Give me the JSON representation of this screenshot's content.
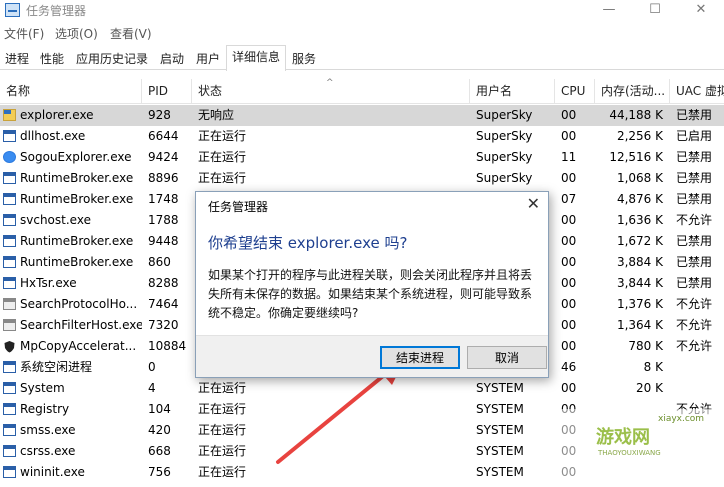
{
  "window": {
    "title": "任务管理器",
    "minimize": "—",
    "maximize": "☐",
    "close": "✕"
  },
  "menu": [
    "文件(F)",
    "选项(O)",
    "查看(V)"
  ],
  "tabs": [
    "进程",
    "性能",
    "应用历史记录",
    "启动",
    "用户",
    "详细信息",
    "服务"
  ],
  "active_tab": "详细信息",
  "columns": {
    "name": "名称",
    "pid": "PID",
    "status": "状态",
    "user": "用户名",
    "cpu": "CPU",
    "mem": "内存(活动...",
    "uac": "UAC 虚拟..."
  },
  "rows": [
    {
      "icon": "folder-icon",
      "name": "explorer.exe",
      "pid": "928",
      "status": "无响应",
      "user": "SuperSky",
      "cpu": "00",
      "mem": "44,188 K",
      "uac": "已禁用"
    },
    {
      "icon": "process-icon",
      "name": "dllhost.exe",
      "pid": "6644",
      "status": "正在运行",
      "user": "SuperSky",
      "cpu": "00",
      "mem": "2,256 K",
      "uac": "已启用"
    },
    {
      "icon": "sogou-icon",
      "name": "SogouExplorer.exe",
      "pid": "9424",
      "status": "正在运行",
      "user": "SuperSky",
      "cpu": "11",
      "mem": "12,516 K",
      "uac": "已禁用"
    },
    {
      "icon": "process-icon",
      "name": "RuntimeBroker.exe",
      "pid": "8896",
      "status": "正在运行",
      "user": "SuperSky",
      "cpu": "00",
      "mem": "1,068 K",
      "uac": "已禁用"
    },
    {
      "icon": "process-icon",
      "name": "RuntimeBroker.exe",
      "pid": "1748",
      "status": "",
      "user": "",
      "cpu": "07",
      "mem": "4,876 K",
      "uac": "已禁用"
    },
    {
      "icon": "process-icon",
      "name": "svchost.exe",
      "pid": "1788",
      "status": "",
      "user": "",
      "cpu": "00",
      "mem": "1,636 K",
      "uac": "不允许"
    },
    {
      "icon": "process-icon",
      "name": "RuntimeBroker.exe",
      "pid": "9448",
      "status": "",
      "user": "",
      "cpu": "00",
      "mem": "1,672 K",
      "uac": "已禁用"
    },
    {
      "icon": "process-icon",
      "name": "RuntimeBroker.exe",
      "pid": "860",
      "status": "",
      "user": "",
      "cpu": "00",
      "mem": "3,884 K",
      "uac": "已禁用"
    },
    {
      "icon": "process-icon",
      "name": "HxTsr.exe",
      "pid": "8288",
      "status": "",
      "user": "",
      "cpu": "00",
      "mem": "3,844 K",
      "uac": "已禁用"
    },
    {
      "icon": "search-icon",
      "name": "SearchProtocolHo...",
      "pid": "7464",
      "status": "",
      "user": "",
      "cpu": "00",
      "mem": "1,376 K",
      "uac": "不允许"
    },
    {
      "icon": "search-icon",
      "name": "SearchFilterHost.exe",
      "pid": "7320",
      "status": "",
      "user": "",
      "cpu": "00",
      "mem": "1,364 K",
      "uac": "不允许"
    },
    {
      "icon": "shield-icon",
      "name": "MpCopyAccelerat...",
      "pid": "10884",
      "status": "",
      "user": "",
      "cpu": "00",
      "mem": "780 K",
      "uac": "不允许"
    },
    {
      "icon": "process-icon",
      "name": "系统空闲进程",
      "pid": "0",
      "status": "",
      "user": "",
      "cpu": "46",
      "mem": "8 K",
      "uac": ""
    },
    {
      "icon": "process-icon",
      "name": "System",
      "pid": "4",
      "status": "正在运行",
      "user": "SYSTEM",
      "cpu": "00",
      "mem": "20 K",
      "uac": ""
    },
    {
      "icon": "process-icon",
      "name": "Registry",
      "pid": "104",
      "status": "正在运行",
      "user": "SYSTEM",
      "cpu": "00",
      "mem": "",
      "uac": "不允许"
    },
    {
      "icon": "process-icon",
      "name": "smss.exe",
      "pid": "420",
      "status": "正在运行",
      "user": "SYSTEM",
      "cpu": "00",
      "mem": "",
      "uac": ""
    },
    {
      "icon": "process-icon",
      "name": "csrss.exe",
      "pid": "668",
      "status": "正在运行",
      "user": "SYSTEM",
      "cpu": "00",
      "mem": "",
      "uac": ""
    },
    {
      "icon": "process-icon",
      "name": "wininit.exe",
      "pid": "756",
      "status": "正在运行",
      "user": "SYSTEM",
      "cpu": "00",
      "mem": "",
      "uac": ""
    }
  ],
  "selected_row": 0,
  "dialog": {
    "title": "任务管理器",
    "close": "✕",
    "heading": "你希望结束 explorer.exe 吗?",
    "message": "如果某个打开的程序与此进程关联，则会关闭此程序并且将丢失所有未保存的数据。如果结束某个系统进程，则可能导致系统不稳定。你确定要继续吗?",
    "confirm_label": "结束进程",
    "cancel_label": "取消"
  },
  "watermark": {
    "brand": "游戏网",
    "sub": "THAOYOUXIWANG",
    "domain": "xiayx.com"
  },
  "colors": {
    "accent": "#0078d7",
    "arrow": "#e8433f",
    "heading": "#1e3f8f",
    "selected_row": "#d7d7d7"
  }
}
